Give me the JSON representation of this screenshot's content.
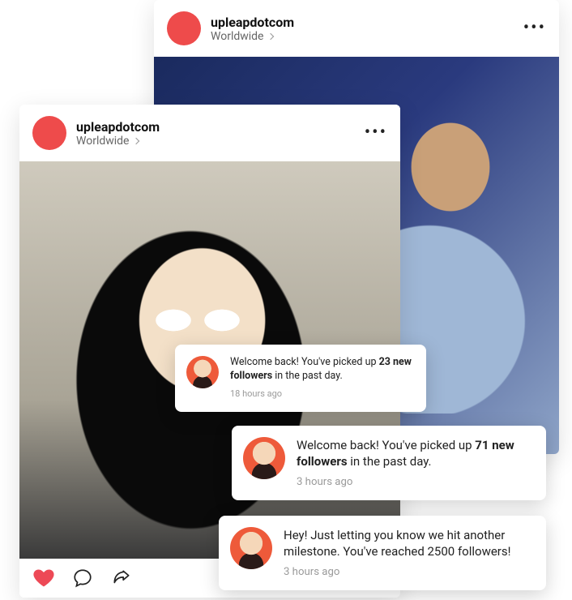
{
  "posts": {
    "back": {
      "username": "upleapdotcom",
      "location": "Worldwide"
    },
    "front": {
      "username": "upleapdotcom",
      "location": "Worldwide"
    }
  },
  "notifications": [
    {
      "prefix": "Welcome back! You've picked up ",
      "bold": "23 new followers",
      "suffix": " in the past day.",
      "time": "18 hours ago"
    },
    {
      "prefix": "Welcome back! You've picked up ",
      "bold": "71 new followers",
      "suffix": " in the past day.",
      "time": "3 hours ago"
    },
    {
      "full": "Hey! Just letting you know we hit another milestone. You've reached 2500 followers!",
      "time": "3 hours ago"
    }
  ],
  "icons": {
    "heart_color": "#ed4956"
  }
}
